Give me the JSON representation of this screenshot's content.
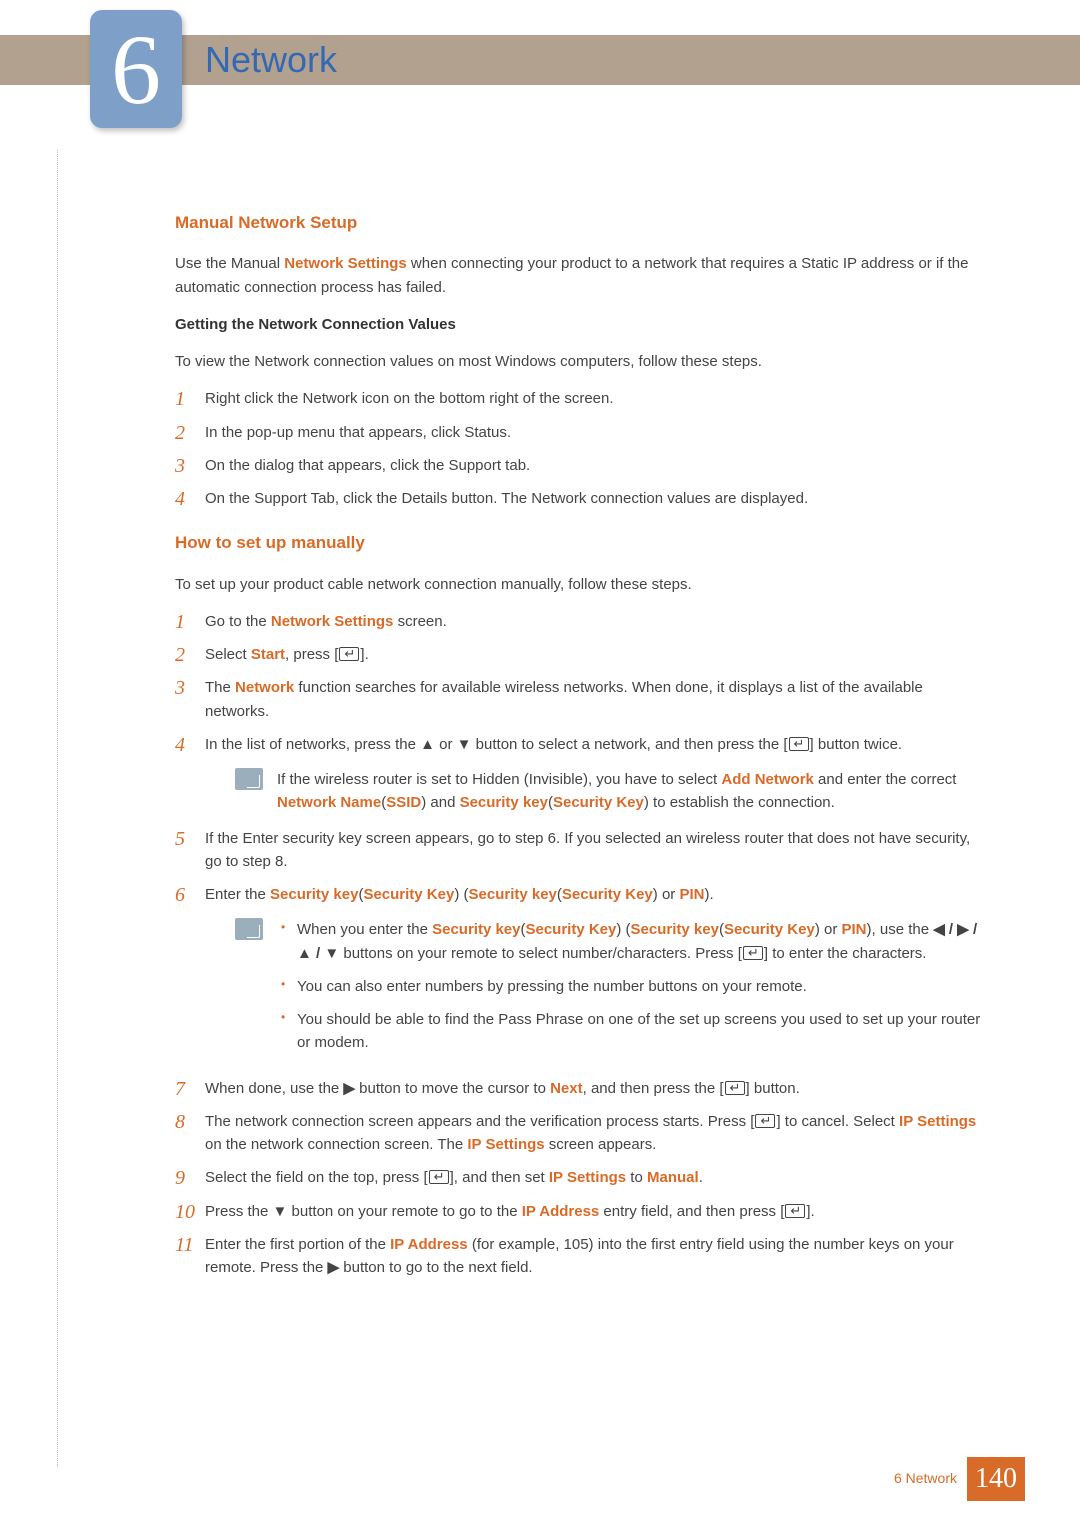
{
  "header": {
    "chapter_number": "6",
    "chapter_title": "Network"
  },
  "section1": {
    "heading": "Manual Network Setup",
    "intro_pre": "Use the Manual ",
    "intro_hl": "Network Settings",
    "intro_post": " when connecting your product to a network that requires a Static IP address or if the automatic connection process has failed.",
    "sub_heading": "Getting the Network Connection Values",
    "sub_intro": "To view the Network connection values on most Windows computers, follow these steps.",
    "steps": [
      "Right click the Network icon on the bottom right of the screen.",
      "In the pop-up menu that appears, click Status.",
      "On the dialog that appears, click the Support tab.",
      "On the Support Tab, click the Details button. The Network connection values are displayed."
    ]
  },
  "section2": {
    "heading": "How to set up manually",
    "intro": "To set up your product cable network connection manually, follow these steps.",
    "s1_pre": "Go to the ",
    "s1_hl": "Network Settings",
    "s1_post": " screen.",
    "s2_pre": "Select ",
    "s2_hl": "Start",
    "s2_post": ", press [",
    "s2_end": "].",
    "s3_pre": "The ",
    "s3_hl": "Network",
    "s3_post": " function searches for available wireless networks. When done, it displays a list of the available networks.",
    "s4_pre": "In the list of networks, press the ",
    "s4_mid": " or ",
    "s4_post": " button to select a network, and then press the [",
    "s4_end": "] button twice.",
    "note1_pre": "If the wireless router is set to Hidden (Invisible), you have to select ",
    "note1_hl1": "Add Network",
    "note1_mid": " and enter the correct ",
    "note1_hl2": "Network Name",
    "note1_p1": "(",
    "note1_hl3": "SSID",
    "note1_p2": ") and ",
    "note1_hl4": "Security key",
    "note1_p3": "(",
    "note1_hl5": "Security Key",
    "note1_p4": ") to establish the connection.",
    "s5": "If the Enter security key screen appears, go to step 6. If you selected an wireless router that does not have security, go to step 8.",
    "s6_pre": "Enter the ",
    "s6_hl1": "Security key",
    "s6_p1": "(",
    "s6_hl2": "Security Key",
    "s6_p2": ") (",
    "s6_hl3": "Security key",
    "s6_p3": "(",
    "s6_hl4": "Security Key",
    "s6_p4": ") or ",
    "s6_hl5": "PIN",
    "s6_p5": ").",
    "note2_b1_pre": "When you enter the ",
    "note2_b1_hl1": "Security key",
    "note2_b1_p1": "(",
    "note2_b1_hl2": "Security Key",
    "note2_b1_p2": ") (",
    "note2_b1_hl3": "Security key",
    "note2_b1_p3": "(",
    "note2_b1_hl4": "Security Key",
    "note2_b1_p4": ") or ",
    "note2_b1_hl5": "PIN",
    "note2_b1_mid": "), use the ",
    "note2_b1_dpad": "◀ / ▶ / ▲ / ▼",
    "note2_b1_post": " buttons on your remote to select number/characters. Press [",
    "note2_b1_end": "] to enter the characters.",
    "note2_b2": "You can also enter numbers by pressing the number buttons on your remote.",
    "note2_b3": "You should be able to find the Pass Phrase on one of the set up screens you used to set up your router or modem.",
    "s7_pre": "When done, use the ",
    "s7_mid": " button to move the cursor to ",
    "s7_hl": "Next",
    "s7_post": ", and then press the [",
    "s7_end": "] button.",
    "s8_pre": "The network connection screen appears and the verification process starts. Press [",
    "s8_mid": "] to cancel. Select ",
    "s8_hl1": "IP Settings",
    "s8_mid2": " on the network connection screen. The ",
    "s8_hl2": "IP Settings",
    "s8_post": " screen appears.",
    "s9_pre": "Select the field on the top, press [",
    "s9_mid": "], and then set ",
    "s9_hl1": "IP Settings",
    "s9_mid2": " to ",
    "s9_hl2": "Manual",
    "s9_end": ".",
    "s10_pre": "Press the ",
    "s10_mid": " button on your remote to go to the ",
    "s10_hl": "IP Address",
    "s10_post": " entry field, and then press [",
    "s10_end": "].",
    "s11_pre": "Enter the first portion of the ",
    "s11_hl": "IP Address",
    "s11_mid": " (for example, 105) into the first entry field using the number keys on your remote. Press the ",
    "s11_post": " button to go to the next field.",
    "nums": {
      "n1": "1",
      "n2": "2",
      "n3": "3",
      "n4": "4",
      "n5": "5",
      "n6": "6",
      "n7": "7",
      "n8": "8",
      "n9": "9",
      "n10": "10",
      "n11": "11"
    }
  },
  "glyphs": {
    "up": "▲",
    "down": "▼",
    "right": "▶"
  },
  "footer": {
    "label": "6  Network",
    "page": "140"
  }
}
